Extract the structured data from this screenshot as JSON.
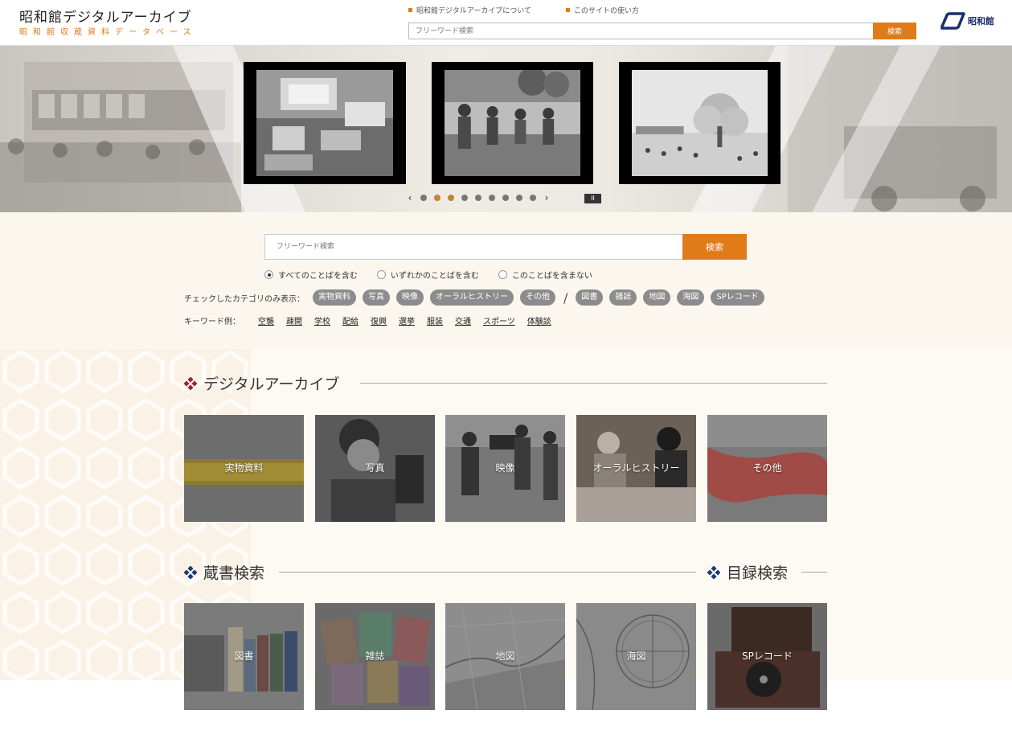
{
  "header": {
    "title": "昭和館デジタルアーカイブ",
    "subtitle": "昭和館収蔵資料データベース",
    "links": [
      "昭和館デジタルアーカイブについて",
      "このサイトの使い方"
    ],
    "search_placeholder": "フリーワード検索",
    "search_button": "検索",
    "logo_text": "昭和館"
  },
  "carousel": {
    "prev": "‹",
    "next": "›",
    "pause": "II",
    "dot_count": 9,
    "active_dots": [
      1,
      2
    ]
  },
  "search": {
    "placeholder": "フリーワード検索",
    "button": "検索",
    "options": [
      "すべてのことばを含む",
      "いずれかのことばを含む",
      "このことばを含まない"
    ],
    "selected_option": 0,
    "category_label": "チェックしたカテゴリのみ表示：",
    "categories_a": [
      "実物資料",
      "写真",
      "映像",
      "オーラルヒストリー",
      "その他"
    ],
    "separator": "/",
    "categories_b": [
      "図書",
      "雑誌",
      "地図",
      "海図",
      "SPレコード"
    ],
    "keyword_label": "キーワード例：",
    "keywords": [
      "空襲",
      "疎開",
      "学校",
      "配給",
      "復興",
      "選挙",
      "服装",
      "交通",
      "スポーツ",
      "体験談"
    ]
  },
  "sections": {
    "digital_archive": {
      "title": "デジタルアーカイブ",
      "cards": [
        "実物資料",
        "写真",
        "映像",
        "オーラルヒストリー",
        "その他"
      ]
    },
    "library": {
      "title": "蔵書検索",
      "cards": [
        "図書",
        "雑誌",
        "地図",
        "海図"
      ]
    },
    "catalog": {
      "title": "目録検索",
      "cards": [
        "SPレコード"
      ]
    }
  },
  "colors": {
    "accent": "#e07b1a",
    "archive_diamond": "#9b2335",
    "library_diamond": "#1b3a7a",
    "chip": "#8c8c8c",
    "panel": "#fcf7ee"
  }
}
